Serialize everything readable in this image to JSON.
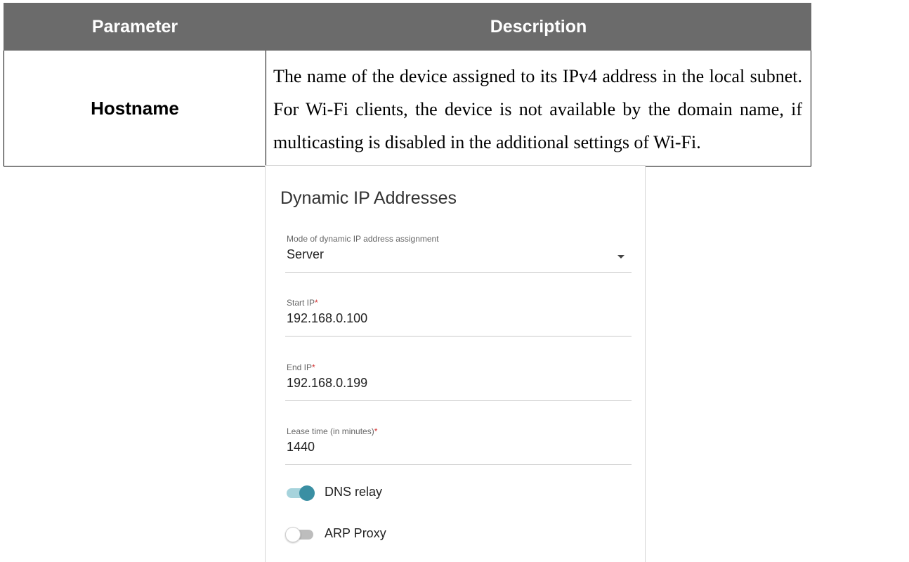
{
  "table": {
    "headers": {
      "parameter": "Parameter",
      "description": "Description"
    },
    "rows": [
      {
        "name": "Hostname",
        "description": "The name of the device assigned to its IPv4 address in the local subnet. For Wi-Fi clients, the device is not available by the domain name, if multicasting is disabled in the additional settings of Wi-Fi."
      }
    ]
  },
  "card": {
    "title": "Dynamic IP Addresses",
    "mode": {
      "label": "Mode of dynamic IP address assignment",
      "value": "Server"
    },
    "start_ip": {
      "label": "Start IP",
      "required_mark": "*",
      "value": "192.168.0.100"
    },
    "end_ip": {
      "label": "End IP",
      "required_mark": "*",
      "value": "192.168.0.199"
    },
    "lease_time": {
      "label": "Lease time (in minutes)",
      "required_mark": "*",
      "value": "1440"
    },
    "toggles": [
      {
        "label": "DNS relay",
        "on": true
      },
      {
        "label": "ARP Proxy",
        "on": false
      }
    ],
    "colors": {
      "toggle_on_knob": "#3a8fa3",
      "toggle_on_track": "#a6d3dc",
      "required_mark": "#d32f2f"
    }
  }
}
